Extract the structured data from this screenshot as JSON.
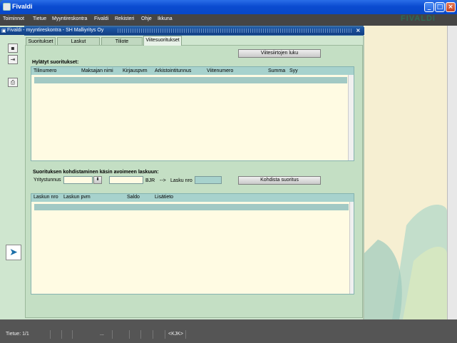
{
  "window": {
    "title": "Fivaldi",
    "logo": "FIVALDI",
    "min_icon": "minimize-icon",
    "max_icon": "maximize-icon",
    "close_icon": "close-icon"
  },
  "menu": [
    "Toiminnot",
    "Tietue",
    "Myyntireskontra",
    "Fivaldi",
    "Rekisteri",
    "Ohje",
    "Ikkuna"
  ],
  "inner_window": {
    "title": "Fivaldi - myyntireskontra - SH Malliyritys Oy",
    "close": "×"
  },
  "toolbar_icons": [
    "save-icon",
    "exit-icon",
    "print-icon"
  ],
  "tabs": [
    "Suoritukset",
    "Laskut",
    "Tiliote",
    "Viitesuoritukset"
  ],
  "active_tab": "Viitesuoritukset",
  "ref_read_button": "Viitesiirtojen luku",
  "rejected": {
    "title": "Hylätyt suoritukset:",
    "columns": [
      "Tilinumero",
      "Maksajan nimi",
      "Kirjauspvm",
      "Arkistointitunnus",
      "Viitenumero",
      "Summa",
      "Syy"
    ]
  },
  "allocate": {
    "title": "Suorituksen kohdistaminen käsin avoimeen laskuun:",
    "company_label": "Yritystunnus",
    "company_value": "",
    "bjr_value": "",
    "bjr_label": "BJR",
    "arrow_label": "-->",
    "invoice_label": "Lasku nro",
    "invoice_value": "",
    "button": "Kohdista suoritus"
  },
  "invoices": {
    "columns": [
      "Laskun nro",
      "Laskun pvm",
      "Saldo",
      "Lisätieto"
    ]
  },
  "status": {
    "record": "Tietue: 1/1",
    "dots": "...",
    "mode": "<KJK>"
  },
  "colors": {
    "accent": "#0a4bd0",
    "panel": "#fffbe3",
    "panel_header": "#a7d2cd",
    "background": "#c4dfc4"
  }
}
